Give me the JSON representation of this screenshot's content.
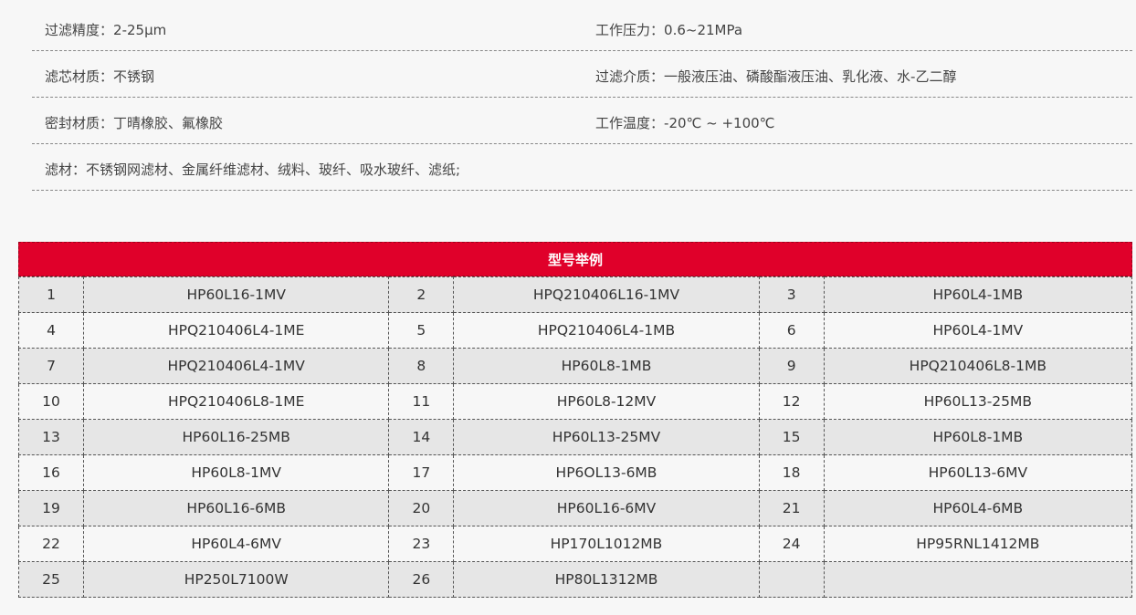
{
  "specs": [
    {
      "left": {
        "label": "过滤精度",
        "value": "2-25μm"
      },
      "right": {
        "label": "工作压力",
        "value": "0.6~21MPa"
      }
    },
    {
      "left": {
        "label": "滤芯材质",
        "value": "不锈钢"
      },
      "right": {
        "label": "过滤介质",
        "value": "一般液压油、磷酸酯液压油、乳化液、水-乙二醇"
      }
    },
    {
      "left": {
        "label": "密封材质",
        "value": "丁晴橡胶、氟橡胶"
      },
      "right": {
        "label": "工作温度",
        "value": "-20℃ ~ +100℃"
      }
    },
    {
      "left": {
        "label": "滤材",
        "value": "不锈钢网滤材、金属纤维滤材、绒料、玻纤、吸水玻纤、滤纸;"
      },
      "right": null
    }
  ],
  "separator": "：",
  "models": {
    "title": "型号举例",
    "rows": [
      [
        [
          "1",
          "HP60L16-1MV"
        ],
        [
          "2",
          "HPQ210406L16-1MV"
        ],
        [
          "3",
          "HP60L4-1MB"
        ]
      ],
      [
        [
          "4",
          "HPQ210406L4-1ME"
        ],
        [
          "5",
          "HPQ210406L4-1MB"
        ],
        [
          "6",
          "HP60L4-1MV"
        ]
      ],
      [
        [
          "7",
          "HPQ210406L4-1MV"
        ],
        [
          "8",
          "HP60L8-1MB"
        ],
        [
          "9",
          "HPQ210406L8-1MB"
        ]
      ],
      [
        [
          "10",
          "HPQ210406L8-1ME"
        ],
        [
          "11",
          "HP60L8-12MV"
        ],
        [
          "12",
          "HP60L13-25MB"
        ]
      ],
      [
        [
          "13",
          "HP60L16-25MB"
        ],
        [
          "14",
          "HP60L13-25MV"
        ],
        [
          "15",
          "HP60L8-1MB"
        ]
      ],
      [
        [
          "16",
          "HP60L8-1MV"
        ],
        [
          "17",
          "HP6OL13-6MB"
        ],
        [
          "18",
          "HP60L13-6MV"
        ]
      ],
      [
        [
          "19",
          "HP60L16-6MB"
        ],
        [
          "20",
          "HP60L16-6MV"
        ],
        [
          "21",
          "HP60L4-6MB"
        ]
      ],
      [
        [
          "22",
          "HP60L4-6MV"
        ],
        [
          "23",
          "HP170L1012MB"
        ],
        [
          "24",
          "HP95RNL1412MB"
        ]
      ],
      [
        [
          "25",
          "HP250L7100W"
        ],
        [
          "26",
          "HP80L1312MB"
        ],
        [
          "",
          ""
        ]
      ]
    ]
  }
}
